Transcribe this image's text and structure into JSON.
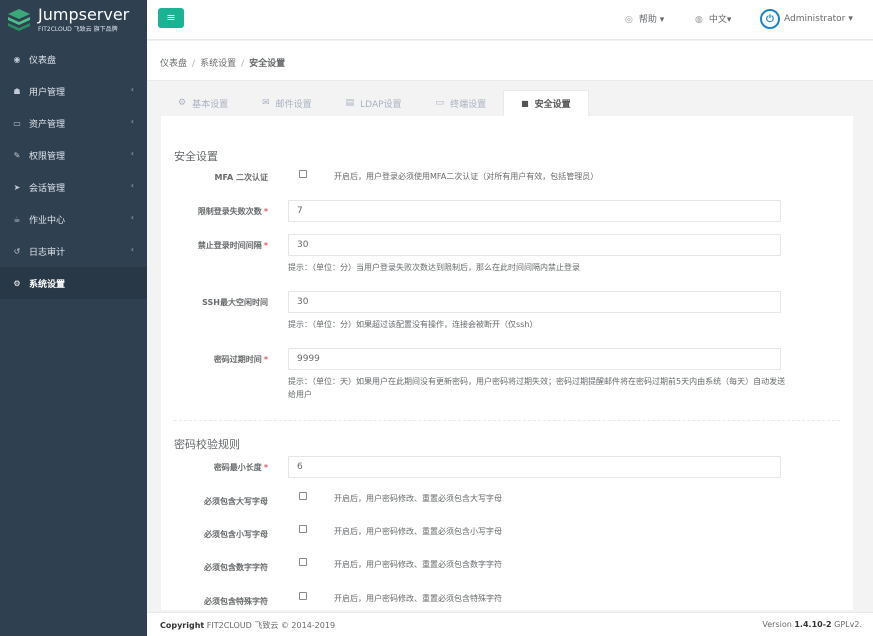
{
  "brand": {
    "name": "Jumpserver",
    "subtitle": "FIT2CLOUD 飞致云 旗下品牌"
  },
  "sidebar": {
    "items": [
      {
        "label": "仪表盘",
        "icon": "dashboard-icon",
        "chevron": ""
      },
      {
        "label": "用户管理",
        "icon": "users-icon",
        "chevron": "‹"
      },
      {
        "label": "资产管理",
        "icon": "inbox-icon",
        "chevron": "‹"
      },
      {
        "label": "权限管理",
        "icon": "edit-icon",
        "chevron": "‹"
      },
      {
        "label": "会话管理",
        "icon": "rocket-icon",
        "chevron": "‹"
      },
      {
        "label": "作业中心",
        "icon": "coffee-icon",
        "chevron": "‹"
      },
      {
        "label": "日志审计",
        "icon": "history-icon",
        "chevron": "‹"
      },
      {
        "label": "系统设置",
        "icon": "gears-icon",
        "chevron": ""
      }
    ],
    "active_index": 7
  },
  "topbar": {
    "menu_icon": "≡",
    "help_label": "帮助",
    "lang_label": "中文",
    "user_label": "Administrator",
    "caret": "▾"
  },
  "breadcrumb": {
    "items": [
      "仪表盘",
      "系统设置",
      "安全设置"
    ],
    "sep": "/"
  },
  "tabs": [
    {
      "label": "基本设置",
      "icon": "cubes-icon",
      "glyph": "⚙"
    },
    {
      "label": "邮件设置",
      "icon": "envelope-icon",
      "glyph": "✉"
    },
    {
      "label": "LDAP设置",
      "icon": "database-icon",
      "glyph": "▤"
    },
    {
      "label": "终端设置",
      "icon": "hdd-icon",
      "glyph": "▭"
    },
    {
      "label": "安全设置",
      "icon": "lock-icon",
      "glyph": "🔒"
    }
  ],
  "active_tab": 4,
  "security": {
    "section_title": "安全设置",
    "mfa_label": "MFA 二次认证",
    "mfa_help": "开启后，用户登录必须使用MFA二次认证（对所有用户有效，包括管理员）",
    "mfa_checked": false,
    "login_limit_label": "限制登录失败次数",
    "login_limit_value": "7",
    "login_interval_label": "禁止登录时间间隔",
    "login_interval_value": "30",
    "login_interval_help": "提示：（单位：分）当用户登录失败次数达到限制后，那么在此时间间隔内禁止登录",
    "ssh_idle_label": "SSH最大空闲时间",
    "ssh_idle_value": "30",
    "ssh_idle_help": "提示：（单位：分）如果超过该配置没有操作，连接会被断开（仅ssh）",
    "pwd_expire_label": "密码过期时间",
    "pwd_expire_value": "9999",
    "pwd_expire_help": "提示：（单位：天）如果用户在此期间没有更新密码，用户密码将过期失效；密码过期提醒邮件将在密码过期前5天内由系统（每天）自动发送给用户"
  },
  "password_rules": {
    "section_title": "密码校验规则",
    "min_length_label": "密码最小长度",
    "min_length_value": "6",
    "upper_label": "必须包含大写字母",
    "upper_help": "开启后，用户密码修改、重置必须包含大写字母",
    "lower_label": "必须包含小写字母",
    "lower_help": "开启后，用户密码修改、重置必须包含小写字母",
    "number_label": "必须包含数字字符",
    "number_help": "开启后，用户密码修改、重置必须包含数字字符",
    "special_label": "必须包含特殊字符",
    "special_help": "开启后，用户密码修改、重置必须包含特殊字符"
  },
  "required_mark": "*",
  "footer": {
    "copyright_bold": "Copyright",
    "copyright_text": "FIT2CLOUD 飞致云 © 2014-2019",
    "version_prefix": "Version",
    "version_number": "1.4.10-2",
    "version_suffix": "GPLv2."
  },
  "colors": {
    "sidebar_bg": "#2f4050",
    "accent": "#1ab394",
    "required": "#ed5565"
  }
}
